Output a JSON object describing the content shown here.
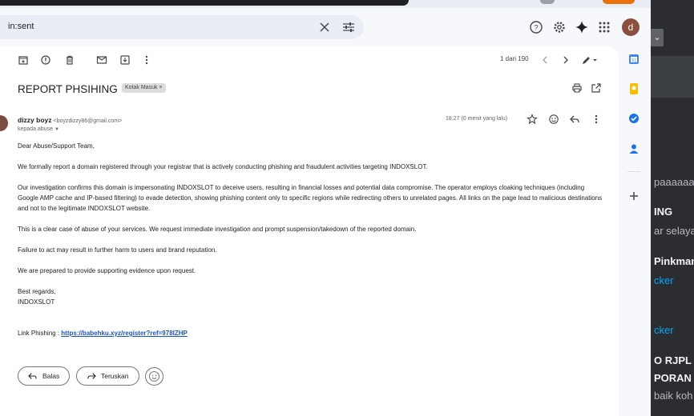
{
  "search": {
    "query": "in:sent"
  },
  "header": {
    "avatar_letter": "d"
  },
  "toolbar": {
    "pager": "1 dari 190"
  },
  "email": {
    "subject": "REPORT PHSIHING",
    "label": "Kotak Masuk ×",
    "sender_name": "dizzy boyz",
    "sender_email": "<boyzdizzy86@gmail.com>",
    "recipient": "kepada abuse",
    "time": "18.27 (0 menit yang lalu)",
    "greeting": "Dear Abuse/Support Team,",
    "p1": "We formally report a domain registered through your registrar that is actively conducting phishing and fraudulent activities targeting INDOXSLOT.",
    "p2": "Our investigation confirms this domain is impersonating INDOXSLOT to deceive users, resulting in financial losses and potential data compromise. The operator employs cloaking techniques (including Google AMP cache and IP-based filtering) to evade detection, showing phishing content only to specific regions while redirecting others to unrelated pages. All links on the page lead to malicious destinations and not to the legitimate INDOXSLOT website.",
    "p3": "This is a clear case of abuse of your services. We request immediate investigation and prompt suspension/takedown of the reported domain.",
    "p4": "Failure to act may result in further harm to users and brand reputation.",
    "p5": "We are prepared to provide supporting evidence upon request.",
    "sign1": "Best regards,",
    "sign2": "INDOXSLOT",
    "link_label": "Link Phishing : ",
    "link_url": "https://babehku.xyz/register?ref=978IZHP"
  },
  "actions": {
    "reply": "Balas",
    "forward": "Teruskan"
  },
  "background_app": {
    "lines": [
      {
        "text": "paaaaaa",
        "style": "g"
      },
      {
        "text": "ING",
        "style": "b"
      },
      {
        "text": "ar selaya",
        "style": "g"
      },
      {
        "text": "Pinkman",
        "style": "b"
      },
      {
        "text": "cker",
        "style": "l"
      },
      {
        "text": "cker",
        "style": "l"
      },
      {
        "text": "O RJPL",
        "style": "b"
      },
      {
        "text": "PORAN L",
        "style": "b"
      },
      {
        "text": "baik koh",
        "style": "g"
      }
    ]
  }
}
